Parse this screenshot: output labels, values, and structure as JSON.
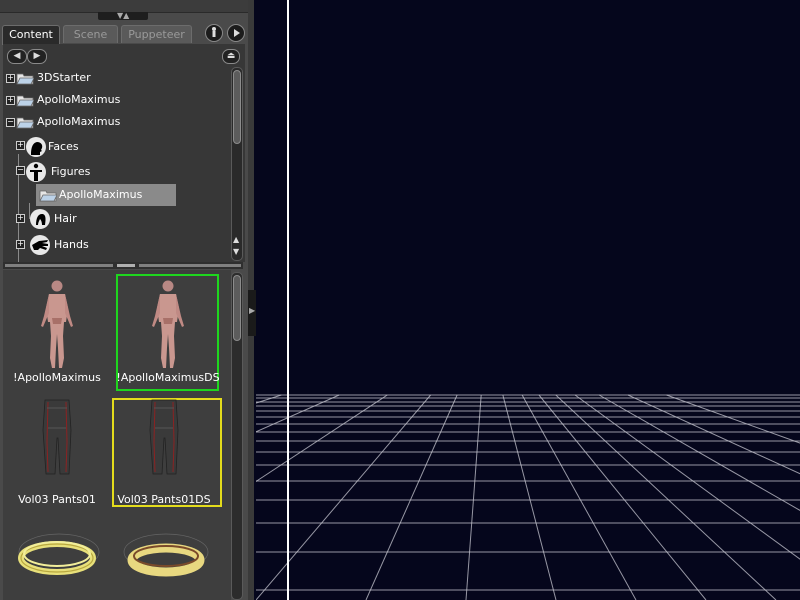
{
  "tabs": {
    "content": "Content",
    "scene": "Scene",
    "puppeteer": "Puppeteer"
  },
  "icons": {
    "back": "arrow-left-icon",
    "forward": "arrow-right-icon",
    "up": "folder-up-icon",
    "figure": "figure-icon",
    "play": "play-icon"
  },
  "tree": {
    "items": [
      {
        "label": "3DStarter",
        "expander": "+"
      },
      {
        "label": "ApolloMaximus",
        "expander": "+"
      },
      {
        "label": "ApolloMaximus",
        "expander": "−"
      },
      {
        "label": "Faces",
        "expander": "+"
      },
      {
        "label": "Figures",
        "expander": "−"
      },
      {
        "label": "ApolloMaximus",
        "expander": ""
      },
      {
        "label": "Hair",
        "expander": "+"
      },
      {
        "label": "Hands",
        "expander": "+"
      }
    ]
  },
  "thumbnails": {
    "items": [
      {
        "label": "!ApolloMaximus",
        "highlight": ""
      },
      {
        "label": "!ApolloMaximusDS",
        "highlight": "green"
      },
      {
        "label": "Vol03 Pants01",
        "highlight": ""
      },
      {
        "label": "Vol03 Pants01DS",
        "highlight": "yellow"
      },
      {
        "label": "",
        "highlight": ""
      },
      {
        "label": "",
        "highlight": ""
      }
    ]
  },
  "colors": {
    "viewport_bg": "#05061c",
    "grid": "#c8c8d2",
    "highlight_green": "#1ed61e",
    "highlight_yellow": "#e4dc1c"
  }
}
